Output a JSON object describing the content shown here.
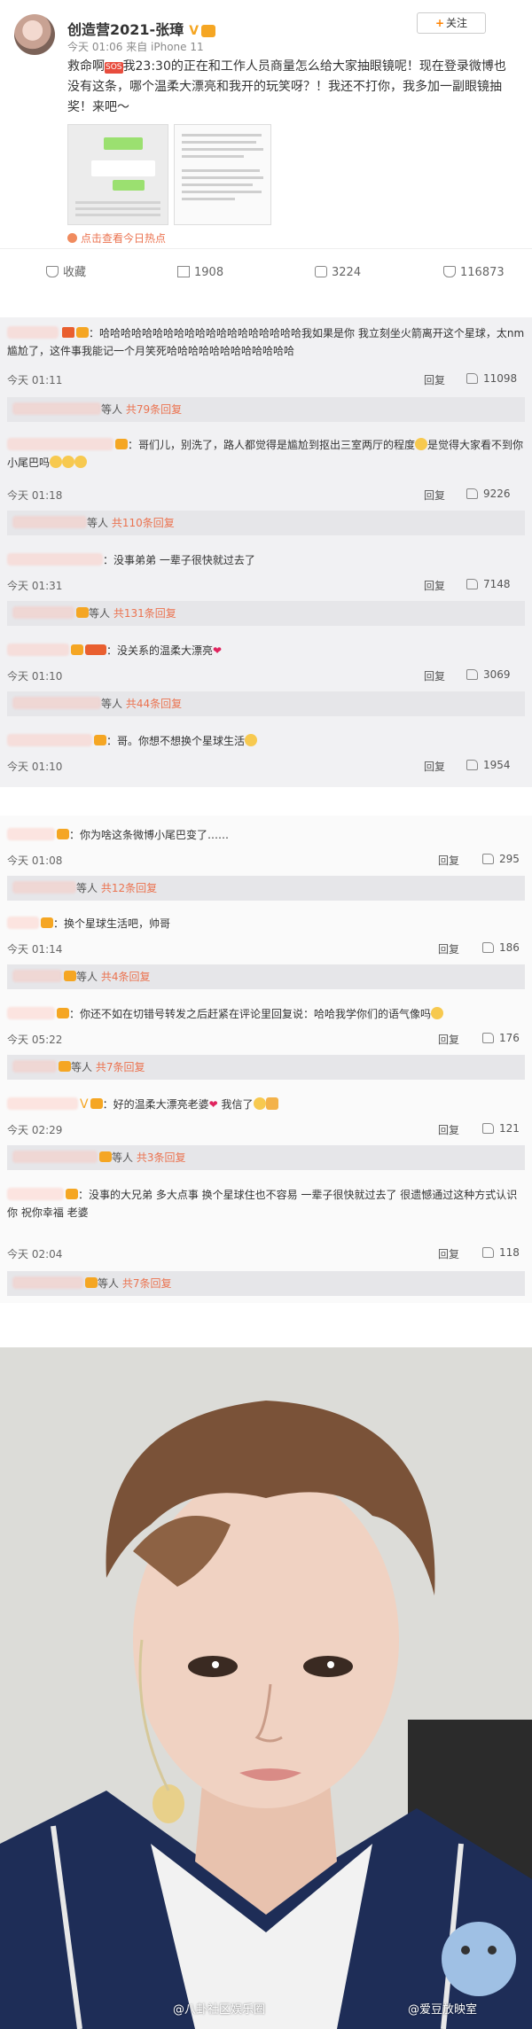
{
  "post": {
    "username": "创造营2021-张璋",
    "meta": "今天 01:06 来自 iPhone 11",
    "follow_label": "关注",
    "text_before_icon": "救命啊",
    "text_after_icon": "我23:30的正在和工作人员商量怎么给大家抽眼镜呢！现在登录微博也没有这条，哪个温柔大漂亮和我开的玩笑呀？！我还不打你，我多加一副眼镜抽奖！来吧～",
    "hot_link": "点击查看今日热点",
    "actions": {
      "favorite": "收藏",
      "repost": "1908",
      "comment": "3224",
      "like": "116873"
    }
  },
  "comments": [
    {
      "text": "哈哈哈哈哈哈哈哈哈哈哈哈哈哈哈哈哈哈哈我如果是你 我立刻坐火箭离开这个星球，太nm尴尬了，这件事我能记一个月笑死哈哈哈哈哈哈哈哈哈哈哈哈",
      "time": "今天 01:11",
      "reply": "回复",
      "likes": "11098",
      "sub": {
        "text": "等人",
        "count": "共79条回复"
      }
    },
    {
      "text": "哥们儿，别洗了，路人都觉得是尴尬到抠出三室两厅的程度",
      "text2": "是觉得大家看不到你小尾巴吗",
      "time": "今天 01:18",
      "reply": "回复",
      "likes": "9226",
      "sub": {
        "text": "等人",
        "count": "共110条回复"
      }
    },
    {
      "text": "没事弟弟 一辈子很快就过去了",
      "time": "今天 01:31",
      "reply": "回复",
      "likes": "7148",
      "sub": {
        "text": "等人",
        "count": "共131条回复"
      }
    },
    {
      "text": "没关系的温柔大漂亮",
      "time": "今天 01:10",
      "reply": "回复",
      "likes": "3069",
      "sub": {
        "text": "等人",
        "count": "共44条回复"
      }
    },
    {
      "text": "哥。你想不想换个星球生活",
      "time": "今天 01:10",
      "reply": "回复",
      "likes": "1954"
    }
  ],
  "comments2": [
    {
      "text": "你为啥这条微博小尾巴变了……",
      "time": "今天 01:08",
      "reply": "回复",
      "likes": "295",
      "sub": {
        "text": "等人",
        "count": "共12条回复"
      }
    },
    {
      "text": "换个星球生活吧，帅哥",
      "time": "今天 01:14",
      "reply": "回复",
      "likes": "186",
      "sub": {
        "text": "等人",
        "count": "共4条回复"
      }
    },
    {
      "text": "你还不如在切错号转发之后赶紧在评论里回复说：哈哈我学你们的语气像吗",
      "time": "今天 05:22",
      "reply": "回复",
      "likes": "176",
      "sub": {
        "text": "等人",
        "count": "共7条回复"
      }
    },
    {
      "text": "好的温柔大漂亮老婆",
      "text2": "我信了",
      "time": "今天 02:29",
      "reply": "回复",
      "likes": "121",
      "sub": {
        "text": "等人",
        "count": "共3条回复"
      }
    },
    {
      "text": "没事的大兄弟 多大点事 换个星球住也不容易 一辈子很快就过去了 很遗憾通过这种方式认识你 祝你幸福 老婆",
      "time": "今天 02:04",
      "reply": "回复",
      "likes": "118",
      "sub": {
        "text": "等人",
        "count": "共7条回复"
      }
    }
  ],
  "watermarks": [
    "@八卦社区娱乐圈",
    "@爱豆放映室"
  ]
}
